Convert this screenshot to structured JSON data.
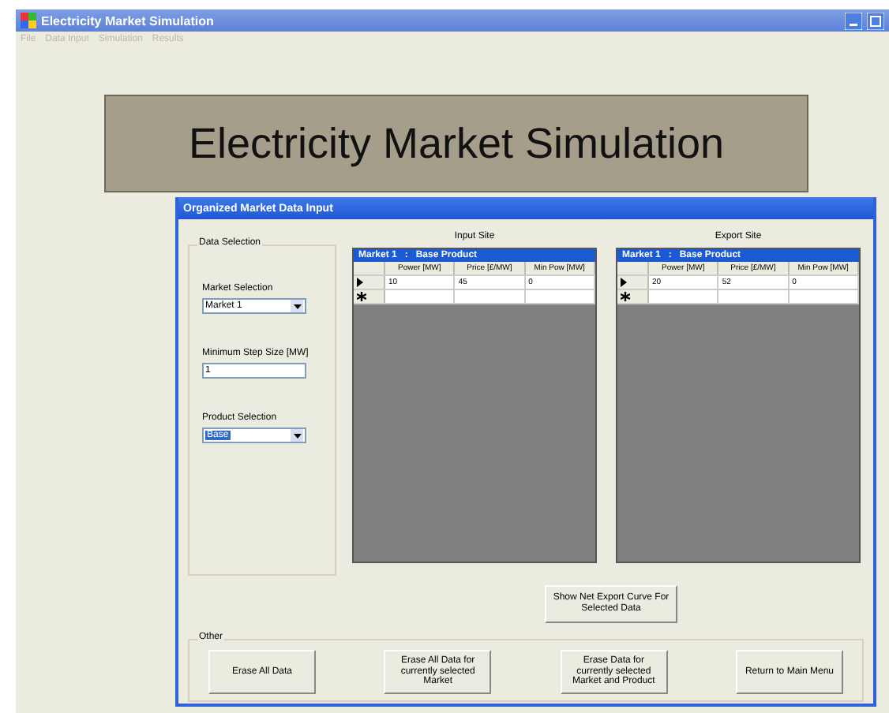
{
  "main_window": {
    "title": "Electricity Market Simulation",
    "menu": [
      "File",
      "Data Input",
      "Simulation",
      "Results"
    ],
    "banner": "Electricity Market Simulation"
  },
  "dialog": {
    "title": "Organized Market Data Input",
    "data_selection": {
      "title": "Data Selection",
      "market_label": "Market Selection",
      "market_value": "Market 1",
      "step_label": "Minimum Step Size [MW]",
      "step_value": "1",
      "product_label": "Product Selection",
      "product_value": "Base",
      "product_highlighted": true
    },
    "grids": [
      {
        "caption": "Input Site",
        "header": "Market 1   :   Base Product",
        "columns": [
          "Power [MW]",
          "Price [£/MW]",
          "Min Pow [MW]"
        ],
        "rows": [
          {
            "current": true,
            "cells": [
              "10",
              "45",
              "0"
            ]
          }
        ]
      },
      {
        "caption": "Export Site",
        "header": "Market 1   :   Base Product",
        "columns": [
          "Power [MW]",
          "Price [£/MW]",
          "Min Pow [MW]"
        ],
        "rows": [
          {
            "current": true,
            "cells": [
              "20",
              "52",
              "0"
            ]
          }
        ]
      }
    ],
    "show_button": "Show Net Export Curve For Selected Data",
    "other": {
      "title": "Other",
      "buttons": [
        "Erase All Data",
        "Erase All Data for currently selected Market",
        "Erase Data for currently selected Market and Product",
        "Return to Main Menu"
      ]
    }
  }
}
